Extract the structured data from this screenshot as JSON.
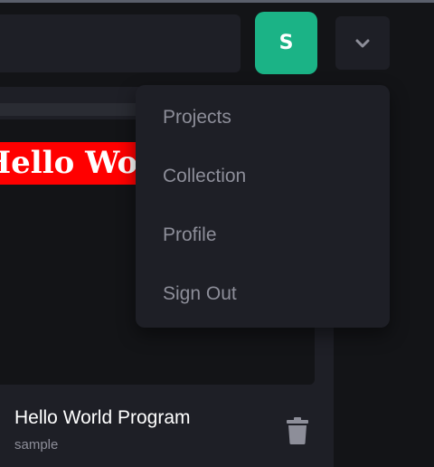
{
  "header": {
    "avatar_letter": "S"
  },
  "menu": {
    "items": [
      {
        "label": "Projects"
      },
      {
        "label": "Collection"
      },
      {
        "label": "Profile"
      },
      {
        "label": "Sign Out"
      }
    ]
  },
  "card": {
    "preview_text": "Hello World",
    "title": "Hello World Program",
    "subtitle": "sample"
  },
  "colors": {
    "background": "#131417",
    "surface": "#1e1f26",
    "accent": "#1bb386",
    "muted_text": "#8d8e99",
    "preview_heading_bg": "#ff0000"
  },
  "icons": [
    "chevron-down-icon",
    "trash-icon"
  ]
}
